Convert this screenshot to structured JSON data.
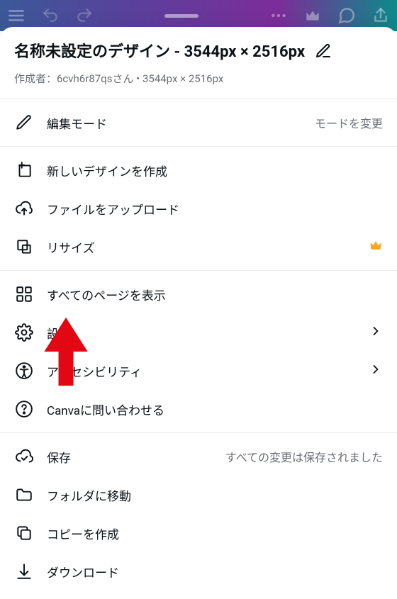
{
  "header": {
    "title": "名称未設定のデザイン - 3544px × 2516px",
    "meta": "作成者：6cvh6r87qsさん • 3544px × 2516px"
  },
  "edit_mode": {
    "label": "編集モード",
    "action": "モードを変更"
  },
  "group_create": {
    "new_design": "新しいデザインを作成",
    "upload_file": "ファイルをアップロード",
    "resize": "リサイズ"
  },
  "group_view": {
    "all_pages": "すべてのページを表示",
    "settings": "設定",
    "accessibility": "アクセシビリティ",
    "contact": "Canvaに問い合わせる"
  },
  "group_save": {
    "save": "保存",
    "save_status": "すべての変更は保存されました",
    "move_folder": "フォルダに移動",
    "copy": "コピーを作成",
    "download": "ダウンロード"
  }
}
